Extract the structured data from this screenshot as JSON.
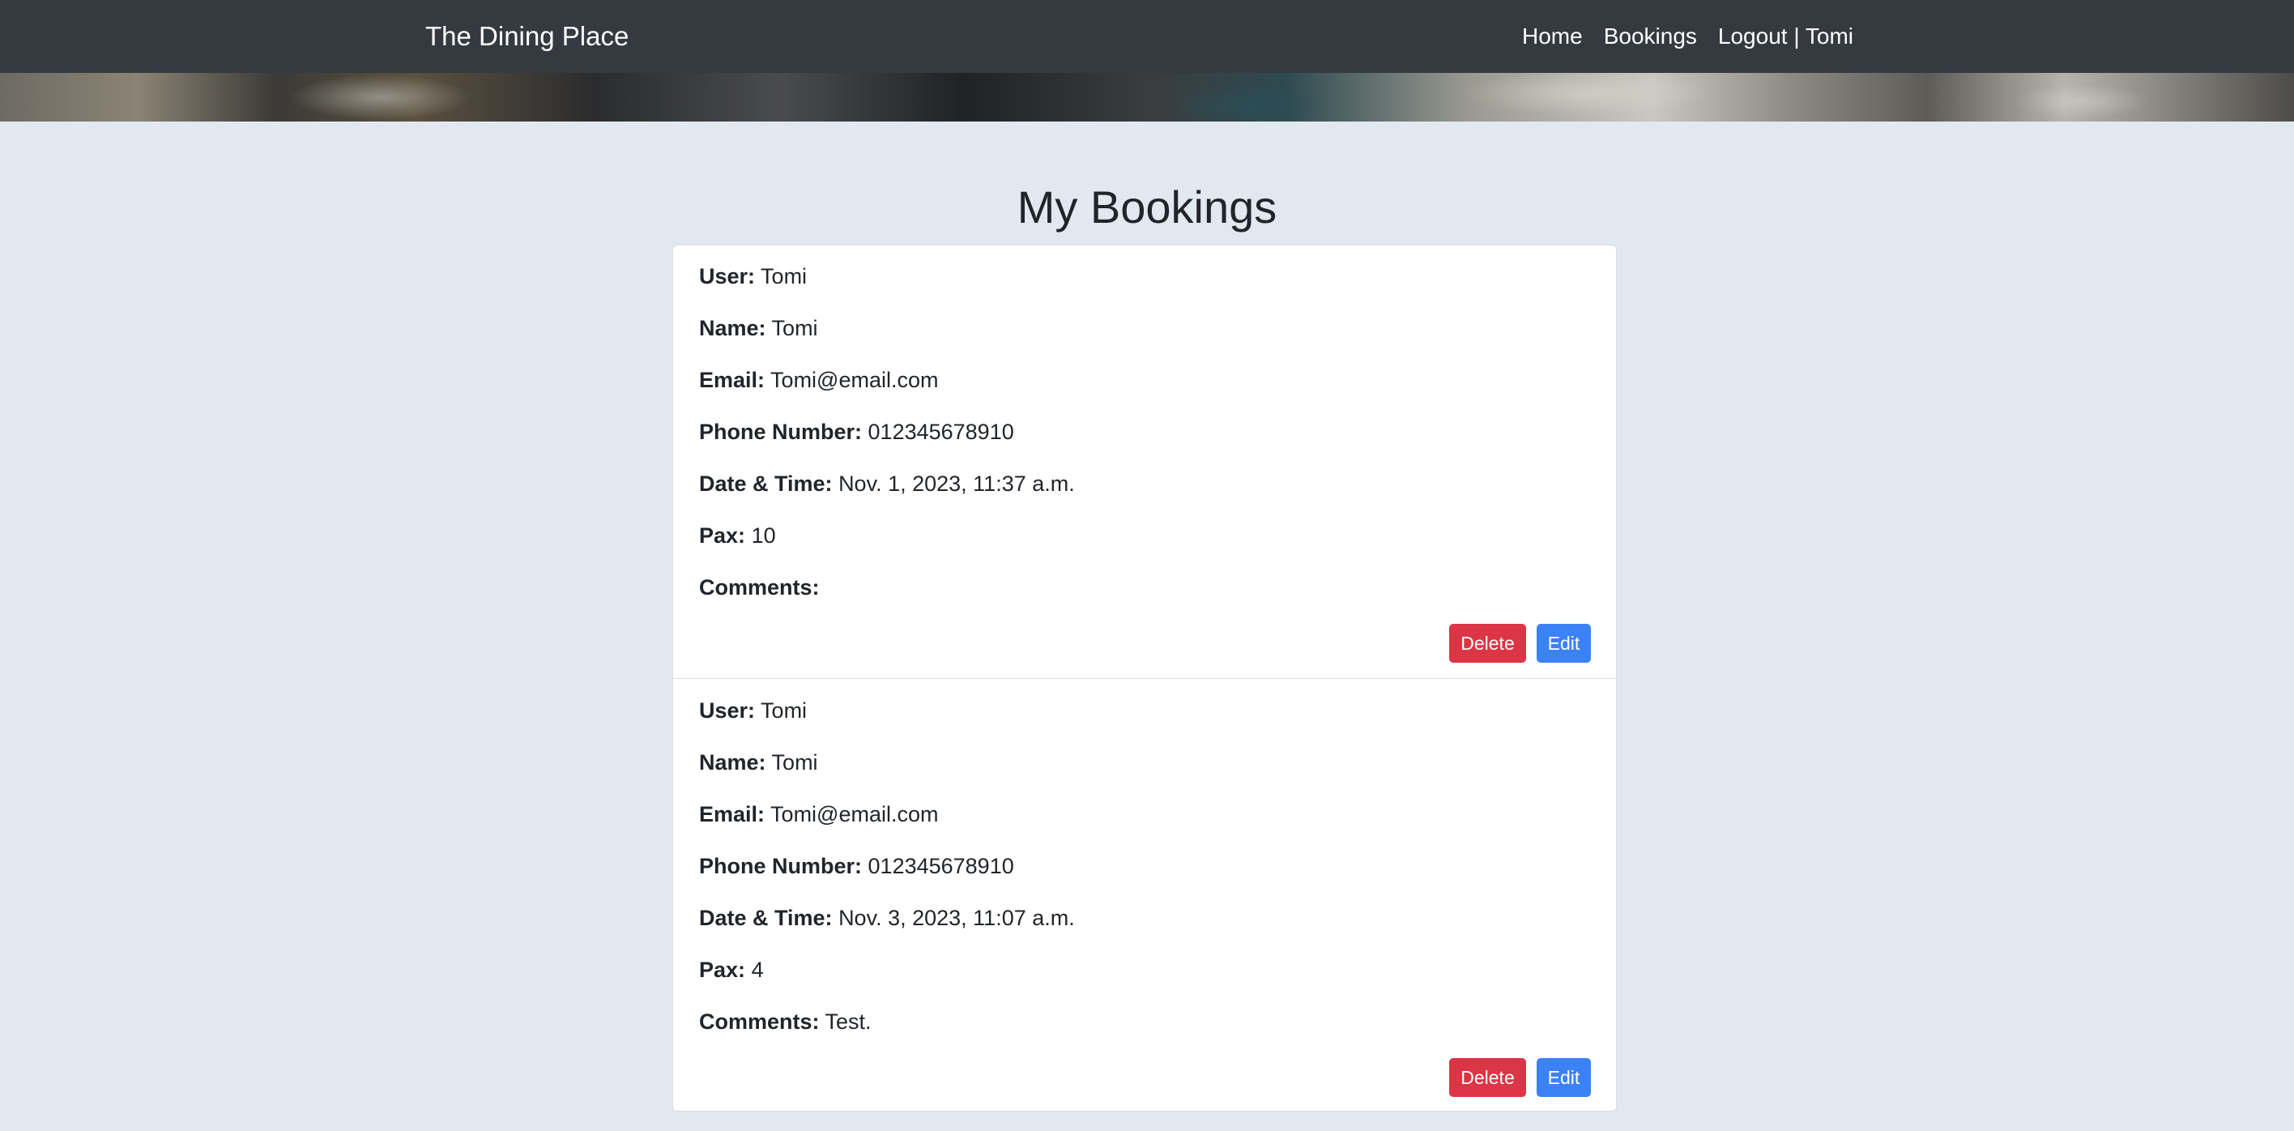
{
  "navbar": {
    "brand": "The Dining Place",
    "links": [
      "Home",
      "Bookings",
      "Logout | Tomi"
    ]
  },
  "page": {
    "title": "My Bookings"
  },
  "labels": {
    "user": "User:",
    "name": "Name:",
    "email": "Email:",
    "phone": "Phone Number:",
    "datetime": "Date & Time:",
    "pax": "Pax:",
    "comments": "Comments:",
    "delete_button": "Delete",
    "edit_button": "Edit"
  },
  "bookings": [
    {
      "user": "Tomi",
      "name": "Tomi",
      "email": "Tomi@email.com",
      "phone": "012345678910",
      "datetime": "Nov. 1, 2023, 11:37 a.m.",
      "pax": "10",
      "comments": ""
    },
    {
      "user": "Tomi",
      "name": "Tomi",
      "email": "Tomi@email.com",
      "phone": "012345678910",
      "datetime": "Nov. 3, 2023, 11:07 a.m.",
      "pax": "4",
      "comments": "Test."
    }
  ],
  "colors": {
    "navbar": "#343a40",
    "background": "#e1e8f0",
    "delete": "#dc3545",
    "edit": "#3b82f6"
  }
}
